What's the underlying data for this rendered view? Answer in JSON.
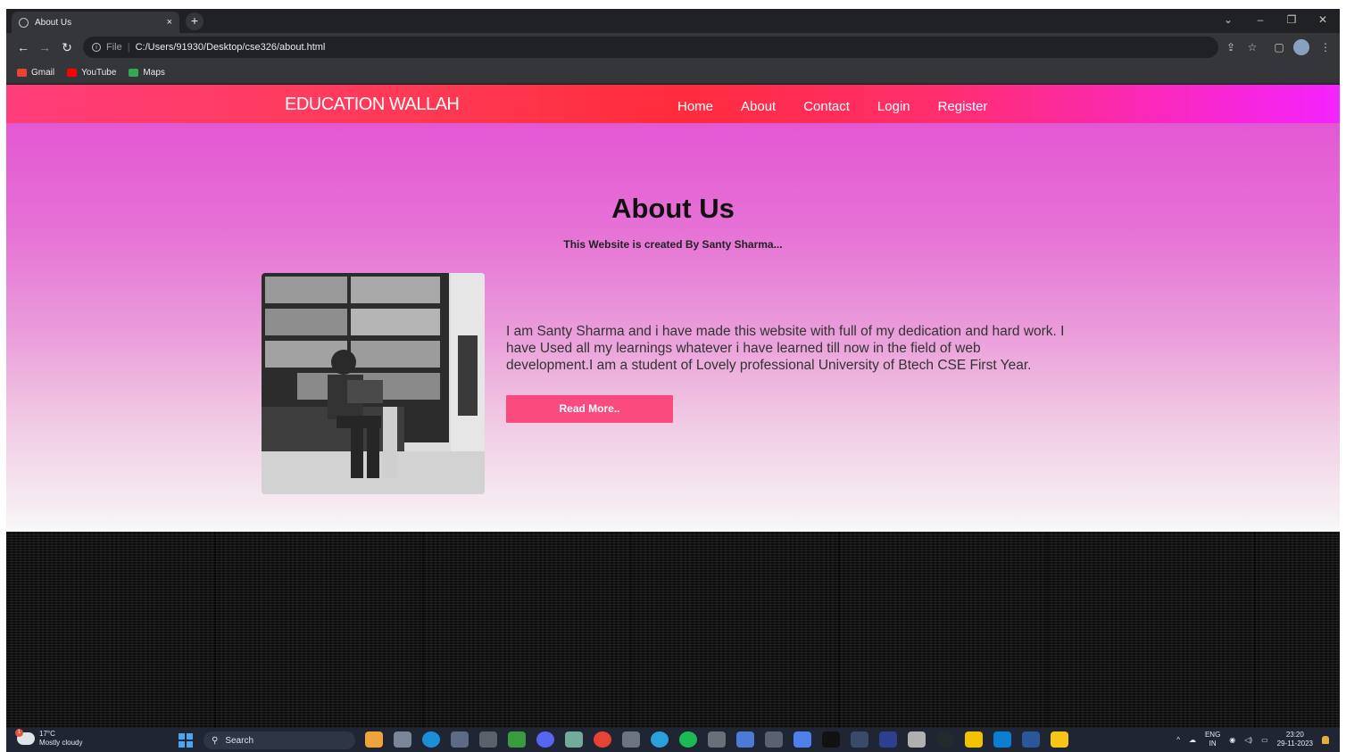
{
  "browser": {
    "tab_title": "About Us",
    "tab_close": "×",
    "new_tab": "+",
    "address_file": "File",
    "address_sep": "|",
    "address_url": "C:/Users/91930/Desktop/cse326/about.html",
    "bookmarks": [
      {
        "label": "Gmail",
        "color": "#ea4335"
      },
      {
        "label": "YouTube",
        "color": "#ff0000"
      },
      {
        "label": "Maps",
        "color": "#34a853"
      }
    ]
  },
  "site": {
    "brand": "EDUCATION WALLAH",
    "menu": [
      "Home",
      "About",
      "Contact",
      "Login",
      "Register"
    ],
    "heading": "About Us",
    "subheading": "This Website is created By Santy Sharma...",
    "paragraph": "I am Santy Sharma and i have made this website with full of my dedication and hard work. I have Used all my learnings whatever i have learned till now in the field of web development.I am a student of Lovely professional University of Btech CSE First Year.",
    "button_label": "Read More..",
    "accent_color": "#fa4a7e"
  },
  "taskbar": {
    "temperature": "17°C",
    "condition": "Mostly cloudy",
    "search_label": "Search",
    "language_top": "ENG",
    "language_bottom": "IN",
    "time": "23:20",
    "date": "29-11-2023",
    "weather_badge": "1"
  }
}
